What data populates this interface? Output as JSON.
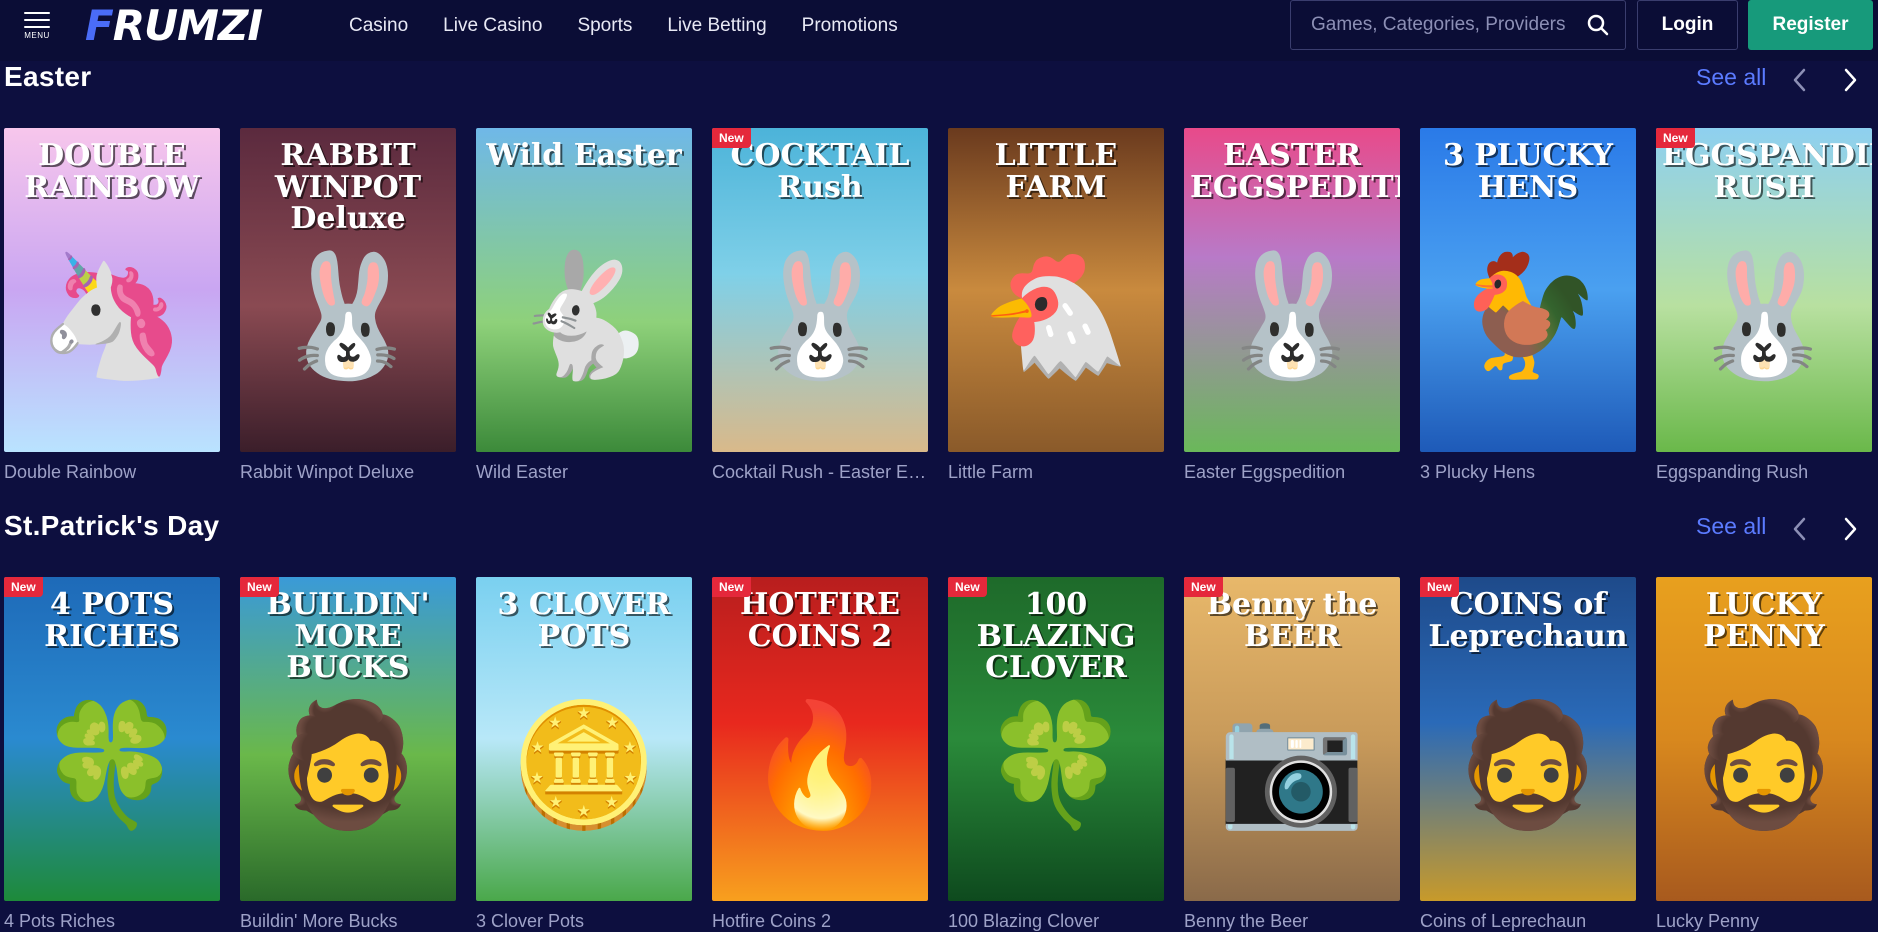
{
  "header": {
    "menu_label": "MENU",
    "logo_first": "F",
    "logo_rest": "RUMZI",
    "nav": [
      "Casino",
      "Live Casino",
      "Sports",
      "Live Betting",
      "Promotions"
    ],
    "search_placeholder": "Games, Categories, Providers",
    "login": "Login",
    "register": "Register"
  },
  "sections": [
    {
      "title": "Easter",
      "see_all": "See all",
      "games": [
        {
          "name": "Double Rainbow",
          "art": "DOUBLE RAINBOW",
          "badge": "",
          "bg": "linear-gradient(180deg,#f7c6ec 0%,#c9a6f2 50%,#b9e3ff 100%)",
          "glyph": "🦄"
        },
        {
          "name": "Rabbit Winpot Deluxe",
          "art": "RABBIT WINPOT Deluxe",
          "badge": "",
          "bg": "linear-gradient(180deg,#5b2a3e 0%,#8a4a52 55%,#3b1e2a 100%)",
          "glyph": "🐰"
        },
        {
          "name": "Wild Easter",
          "art": "Wild Easter",
          "badge": "",
          "bg": "linear-gradient(180deg,#6fb8e8 0%,#8ed17a 60%,#3c8a3a 100%)",
          "glyph": "🐇"
        },
        {
          "name": "Cocktail Rush - Easter Edition",
          "art": "COCKTAIL Rush",
          "badge": "New",
          "bg": "linear-gradient(180deg,#4cb3d9 0%,#7fd0e8 45%,#d9b98a 100%)",
          "glyph": "🐰"
        },
        {
          "name": "Little Farm",
          "art": "LITTLE FARM",
          "badge": "",
          "bg": "linear-gradient(180deg,#6a3a1e 0%,#c98a3e 50%,#8a5a2a 100%)",
          "glyph": "🐔"
        },
        {
          "name": "Easter Eggspedition",
          "art": "EASTER EGGSPEDITION",
          "badge": "",
          "bg": "linear-gradient(180deg,#e84a8a 0%,#b87ac8 40%,#6ab85a 100%)",
          "glyph": "🐰"
        },
        {
          "name": "3 Plucky Hens",
          "art": "3 PLUCKY HENS",
          "badge": "",
          "bg": "linear-gradient(180deg,#2a7ae8 0%,#4aa0f0 50%,#1e5ab8 100%)",
          "glyph": "🐓"
        },
        {
          "name": "Eggspanding Rush",
          "art": "EGGSPANDING RUSH",
          "badge": "New",
          "bg": "linear-gradient(180deg,#8ed0f0 0%,#b8e0a0 55%,#6ab84a 100%)",
          "glyph": "🐰"
        }
      ]
    },
    {
      "title": "St.Patrick's Day",
      "see_all": "See all",
      "games": [
        {
          "name": "4 Pots Riches",
          "art": "4 POTS RICHES",
          "badge": "New",
          "bg": "linear-gradient(180deg,#1e6ab8 0%,#2a8ad0 50%,#1e8a3a 100%)",
          "glyph": "🍀"
        },
        {
          "name": "Buildin' More Bucks",
          "art": "BUILDIN' MORE BUCKS",
          "badge": "New",
          "bg": "linear-gradient(180deg,#3a9ad8 0%,#6ab84a 55%,#2a6a2a 100%)",
          "glyph": "🧔"
        },
        {
          "name": "3 Clover Pots",
          "art": "3 CLOVER POTS",
          "badge": "",
          "bg": "linear-gradient(180deg,#7ad0f0 0%,#b8e8f8 50%,#4aa84a 100%)",
          "glyph": "🪙"
        },
        {
          "name": "Hotfire Coins 2",
          "art": "HOTFIRE COINS 2",
          "badge": "New",
          "bg": "linear-gradient(180deg,#b81e1e 0%,#e8281e 45%,#f8a01e 100%)",
          "glyph": "🔥"
        },
        {
          "name": "100 Blazing Clover",
          "art": "100 BLAZING CLOVER",
          "badge": "New",
          "bg": "linear-gradient(180deg,#1e6a2a 0%,#2a8a3a 50%,#0e4a1e 100%)",
          "glyph": "🍀"
        },
        {
          "name": "Benny the Beer",
          "art": "Benny the BEER",
          "badge": "New",
          "bg": "linear-gradient(180deg,#e8b86a 0%,#c89a5a 50%,#8a6a4a 100%)",
          "glyph": "📷"
        },
        {
          "name": "Coins of Leprechaun",
          "art": "COINS of Leprechaun",
          "badge": "New",
          "bg": "linear-gradient(180deg,#1e4a8a 0%,#2a6ab8 45%,#c89a2a 100%)",
          "glyph": "🧔"
        },
        {
          "name": "Lucky Penny",
          "art": "LUCKY PENNY",
          "badge": "",
          "bg": "linear-gradient(180deg,#e8a01e 0%,#d8881e 50%,#a85a1e 100%)",
          "glyph": "🧔"
        }
      ]
    }
  ]
}
